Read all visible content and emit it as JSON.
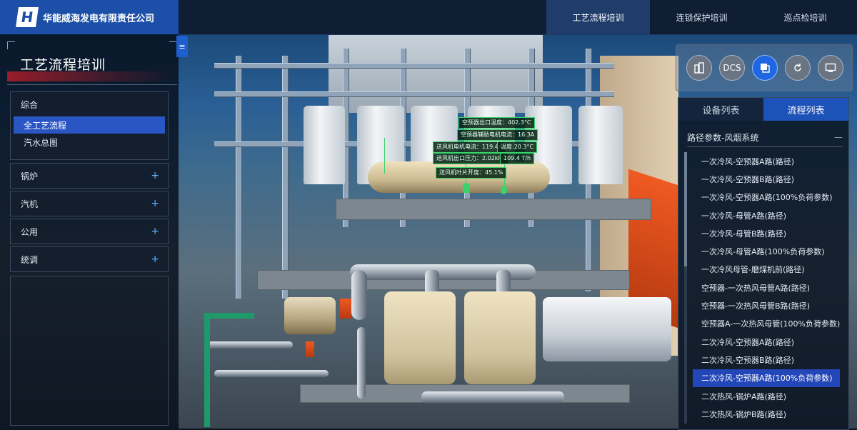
{
  "brand": {
    "logo_letter": "H",
    "company": "华能威海发电有限责任公司"
  },
  "nav": {
    "tabs": [
      {
        "label": "工艺流程培训",
        "active": true
      },
      {
        "label": "连锁保护培训",
        "active": false
      },
      {
        "label": "巡点检培训",
        "active": false
      }
    ]
  },
  "left_panel": {
    "title": "工艺流程培训",
    "groups": [
      {
        "label": "综合",
        "expanded": true,
        "items": [
          {
            "label": "全工艺流程",
            "active": true
          },
          {
            "label": "汽水总图",
            "active": false
          }
        ]
      },
      {
        "label": "锅炉",
        "expanded": false,
        "expand_symbol": "+"
      },
      {
        "label": "汽机",
        "expanded": false,
        "expand_symbol": "+"
      },
      {
        "label": "公用",
        "expanded": false,
        "expand_symbol": "+"
      },
      {
        "label": "统调",
        "expanded": false,
        "expand_symbol": "+"
      }
    ]
  },
  "tools": [
    {
      "name": "building-icon",
      "label": ""
    },
    {
      "name": "dcs-button",
      "label": "DCS"
    },
    {
      "name": "layers-icon",
      "label": "",
      "active": true
    },
    {
      "name": "reset-icon",
      "label": ""
    },
    {
      "name": "screen-icon",
      "label": ""
    }
  ],
  "right_panel": {
    "tabs": [
      {
        "label": "设备列表",
        "active": false
      },
      {
        "label": "流程列表",
        "active": true
      }
    ],
    "section_title": "路径参数-风烟系统",
    "section_symbol": "—",
    "items": [
      "一次冷风-空预器A路(路径)",
      "一次冷风-空预器B路(路径)",
      "一次冷风-空预器A路(100%负荷参数)",
      "一次冷风-母管A路(路径)",
      "一次冷风-母管B路(路径)",
      "一次冷风-母管A路(100%负荷参数)",
      "一次冷风母管-磨煤机前(路径)",
      "空预器-一次热风母管A路(路径)",
      "空预器-一次热风母管B路(路径)",
      "空预器A-一次热风母管(100%负荷参数)",
      "二次冷风-空预器A路(路径)",
      "二次冷风-空预器B路(路径)",
      "二次冷风-空预器A路(100%负荷参数)",
      "二次热风-锅炉A路(路径)",
      "二次热风-锅炉B路(路径)"
    ],
    "active_index": 12
  },
  "tags": [
    "空预器出口温度：402.3°C",
    "空预器辅助电机电流：16.3A",
    "送风机电机电流：119.4A",
    "温度:20.3°C",
    "送风机出口压力：2.02kPa",
    "109.4 T/h",
    "送风机叶片开度：45.1%"
  ],
  "colors": {
    "accent": "#1b4fa8",
    "active_item": "#2346b8",
    "tag_green": "#38d36b"
  }
}
